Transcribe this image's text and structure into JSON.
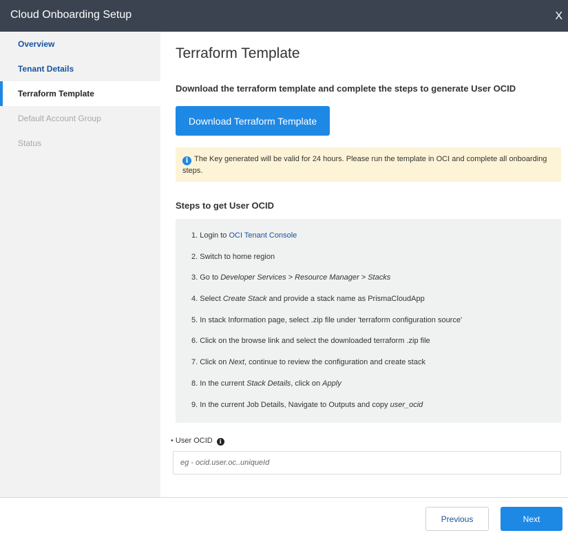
{
  "window": {
    "title": "Cloud Onboarding Setup",
    "close_glyph": "X"
  },
  "sidebar": {
    "items": [
      {
        "label": "Overview",
        "state": "done"
      },
      {
        "label": "Tenant Details",
        "state": "done"
      },
      {
        "label": "Terraform Template",
        "state": "active"
      },
      {
        "label": "Default Account Group",
        "state": "pending"
      },
      {
        "label": "Status",
        "state": "pending"
      }
    ]
  },
  "main": {
    "title": "Terraform Template",
    "subtitle": "Download the terraform template and complete the steps to generate User OCID",
    "download_button": "Download Terraform Template",
    "info": {
      "icon": "info-icon",
      "text": "The Key generated will be valid for 24 hours. Please run the template in OCI and complete all onboarding steps."
    },
    "steps_heading": "Steps to get User OCID",
    "steps": {
      "s1": {
        "prefix": "1. Login to ",
        "link": "OCI Tenant Console"
      },
      "s2": {
        "text": "2. Switch to home region"
      },
      "s3": {
        "prefix": "3. Go to ",
        "em": "Developer Services > Resource Manager > Stacks"
      },
      "s4": {
        "prefix": "4. Select ",
        "em": "Create Stack",
        "suffix": " and provide a stack name as PrismaCloudApp"
      },
      "s5": {
        "text": "5. In stack Information page, select .zip file under 'terraform configuration source'"
      },
      "s6": {
        "text": "6. Click on the browse link and select the downloaded terraform .zip file"
      },
      "s7": {
        "prefix": "7. Click on ",
        "em": "Next",
        "suffix": ", continue to review the configuration and create stack"
      },
      "s8": {
        "prefix": "8. In the current ",
        "em": "Stack Details",
        "mid": ", click on ",
        "em2": "Apply"
      },
      "s9": {
        "prefix": "9. In the current Job Details, Navigate to Outputs and copy ",
        "em": "user_ocid"
      }
    },
    "field": {
      "bullet": "•",
      "label": "User OCID",
      "help_icon": "i",
      "value": "",
      "placeholder": "eg - ocid.user.oc..uniqueId"
    }
  },
  "footer": {
    "previous": "Previous",
    "next": "Next"
  },
  "colors": {
    "header": "#3b4350",
    "accent": "#1e88e5",
    "link": "#17539e",
    "info_bg": "#fdf4d7",
    "steps_bg": "#f0f1f1"
  }
}
